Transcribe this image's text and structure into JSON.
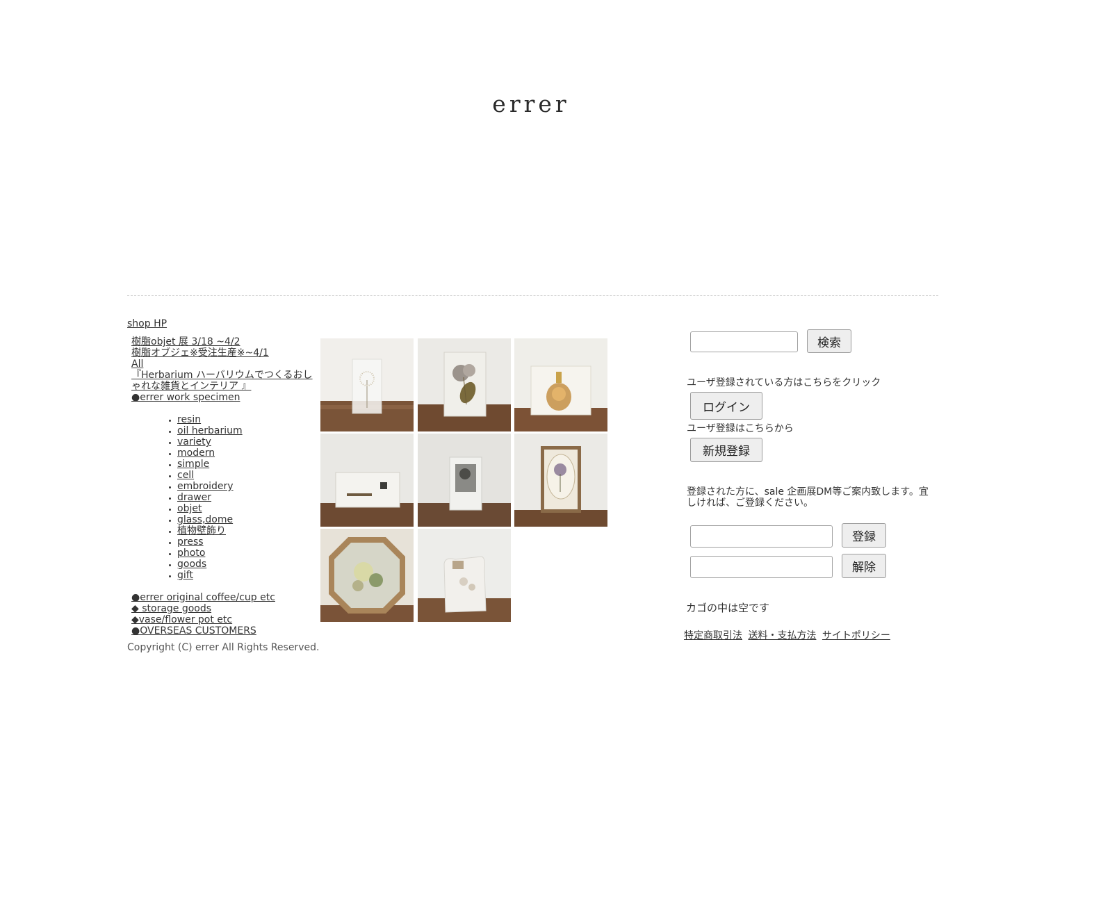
{
  "header": {
    "logo": "errer"
  },
  "sidebar": {
    "shop_hp": "shop HP",
    "top_links": [
      "樹脂objet 展  3/18 ~4/2",
      "樹脂オブジェ※受注生産※~4/1",
      "All",
      "『Herbarium ハーバリウムでつくるおしゃれな雑貨とインテリア 』",
      "●errer work specimen"
    ],
    "sub_links": [
      " resin",
      " oil herbarium",
      " variety",
      " modern",
      " simple",
      " cell",
      " embroidery",
      " drawer",
      "objet",
      "glass,dome",
      "植物壁飾り",
      "press",
      "photo",
      "goods",
      "gift"
    ],
    "bottom_links": [
      "●errer original coffee/cup etc",
      "◆ storage goods",
      "◆vase/flower pot etc",
      "●OVERSEAS CUSTOMERS"
    ],
    "copyright": "Copyright (C) errer All Rights Reserved."
  },
  "products": [
    {
      "name": "dandelion-resin-block"
    },
    {
      "name": "hydrangea-resin-block"
    },
    {
      "name": "perfume-bottle-resin"
    },
    {
      "name": "landscape-resin-plate"
    },
    {
      "name": "botanical-resin-card"
    },
    {
      "name": "oval-framed-flower"
    },
    {
      "name": "octagon-framed-flower"
    },
    {
      "name": "dried-flower-bag"
    }
  ],
  "sidebar_right": {
    "search_button": "検索",
    "login_prompt": "ユーザ登録されている方はこちらをクリック",
    "login_button": "ログイン",
    "register_prompt": "ユーザ登録はこちらから",
    "register_button": "新規登録",
    "newsletter_text": "登録された方に、sale 企画展DM等ご案内致します。宜しければ、ご登録ください。",
    "subscribe_button": "登録",
    "unsubscribe_button": "解除",
    "cart_status": "カゴの中は空です",
    "footer_links": [
      "特定商取引法",
      "送料・支払方法",
      "サイトポリシー"
    ]
  }
}
